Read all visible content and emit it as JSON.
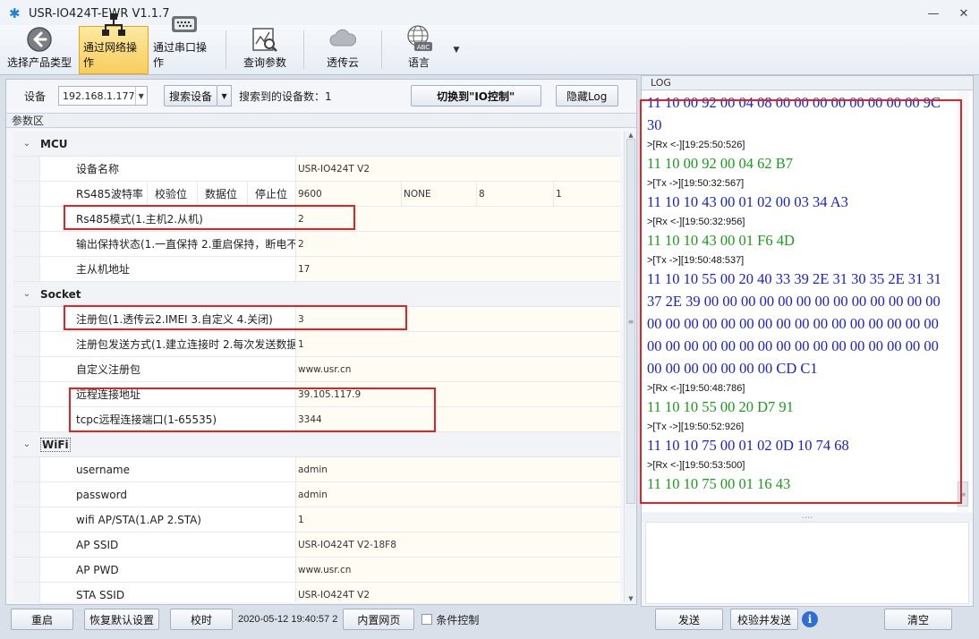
{
  "window": {
    "title": "USR-IO424T-EWR V1.1.7",
    "min_glyph": "—",
    "close_glyph": "✕"
  },
  "toolbar": [
    {
      "label": "选择产品类型",
      "icon": "back-arrow-icon"
    },
    {
      "label": "通过网络操作",
      "icon": "network-icon",
      "active": true
    },
    {
      "label": "通过串口操作",
      "icon": "serial-port-icon"
    },
    {
      "label": "查询参数",
      "icon": "query-chart-icon"
    },
    {
      "label": "透传云",
      "icon": "cloud-icon"
    },
    {
      "label": "语言",
      "icon": "globe-abc-icon"
    }
  ],
  "device_bar": {
    "label": "设备",
    "ip": "192.168.1.177",
    "search_button": "搜索设备",
    "found_label": "搜索到的设备数：1",
    "switch_button": "切换到\"IO控制\"",
    "hide_log_button": "隐藏Log"
  },
  "param_area_label": "参数区",
  "mcu": {
    "title": "MCU",
    "device_name_key": "设备名称",
    "device_name_val": "USR-IO424T V2",
    "serial_keys": [
      "RS485波特率",
      "校验位",
      "数据位",
      "停止位"
    ],
    "serial_vals": [
      "9600",
      "NONE",
      "8",
      "1"
    ],
    "rs485_mode_key": "Rs485模式(1.主机2.从机)",
    "rs485_mode_val": "2",
    "output_keep_key": "输出保持状态(1.一直保持 2.重启保持，断电不",
    "output_keep_val": "2",
    "addr_key": "主从机地址",
    "addr_val": "17"
  },
  "socket": {
    "title": "Socket",
    "reg_pkg_key": "注册包(1.透传云2.IMEI 3.自定义 4.关闭)",
    "reg_pkg_val": "3",
    "reg_send_key": "注册包发送方式(1.建立连接时 2.每次发送数据",
    "reg_send_val": "1",
    "custom_reg_key": "自定义注册包",
    "custom_reg_val": "www.usr.cn",
    "remote_addr_key": "远程连接地址",
    "remote_addr_val": "39.105.117.9",
    "remote_port_key": "tcpc远程连接端口(1-65535)",
    "remote_port_val": "3344"
  },
  "wifi": {
    "title": "WiFi",
    "username_key": "username",
    "username_val": "admin",
    "password_key": "password",
    "password_val": "admin",
    "mode_key": "wifi AP/STA(1.AP 2.STA)",
    "mode_val": "1",
    "ap_ssid_key": "AP SSID",
    "ap_ssid_val": "USR-IO424T V2-18F8",
    "ap_pwd_key": "AP PWD",
    "ap_pwd_val": "www.usr.cn",
    "sta_ssid_key": "STA SSID",
    "sta_ssid_val": "USR-IO424T V2"
  },
  "bottom": {
    "restart": "重启",
    "restore": "恢复默认设置",
    "sync_time": "校时",
    "datetime": "2020-05-12 19:40:57 2",
    "builtin_web": "内置网页",
    "condition_ctrl": "条件控制"
  },
  "log": {
    "label": "LOG",
    "lines": [
      {
        "kind": "tx",
        "text": "11 10 00 92 00 04 08 00 00 00 00 00 00 00 00 9C 30"
      },
      {
        "kind": "stamp",
        "text": ">[Rx <-][19:25:50:526]"
      },
      {
        "kind": "rx",
        "text": "11 10 00 92 00 04 62 B7"
      },
      {
        "kind": "stamp",
        "text": ">[Tx ->][19:50:32:567]"
      },
      {
        "kind": "tx",
        "text": "11 10 10 43 00 01 02 00 03 34 A3"
      },
      {
        "kind": "stamp",
        "text": ">[Rx <-][19:50:32:956]"
      },
      {
        "kind": "rx",
        "text": "11 10 10 43 00 01 F6 4D"
      },
      {
        "kind": "stamp",
        "text": ">[Tx ->][19:50:48:537]"
      },
      {
        "kind": "tx",
        "text": "11 10 10 55 00 20 40 33 39 2E 31 30 35 2E 31 31 37 2E 39 00 00 00 00 00 00 00 00 00 00 00 00 00 00 00 00 00 00 00 00 00 00 00 00 00 00 00 00 00 00 00 00 00 00 00 00 00 00 00 00 00 00 00 00 00 00 00 00 00 00 00 00 CD C1"
      },
      {
        "kind": "stamp",
        "text": ">[Rx <-][19:50:48:786]"
      },
      {
        "kind": "rx",
        "text": "11 10 10 55 00 20 D7 91"
      },
      {
        "kind": "stamp",
        "text": ">[Tx ->][19:50:52:926]"
      },
      {
        "kind": "tx",
        "text": "11 10 10 75 00 01 02 0D 10 74 68"
      },
      {
        "kind": "stamp",
        "text": ">[Rx <-][19:50:53:500]"
      },
      {
        "kind": "rx",
        "text": "11 10 10 75 00 01 16 43"
      }
    ],
    "send_button": "发送",
    "check_send_button": "校验并发送",
    "clear_button": "清空"
  },
  "colors": {
    "highlight_box": "#e02424",
    "tx_text": "#1a22c8",
    "rx_text": "#1c9a1c",
    "active_tab": "#f8cd5c"
  }
}
